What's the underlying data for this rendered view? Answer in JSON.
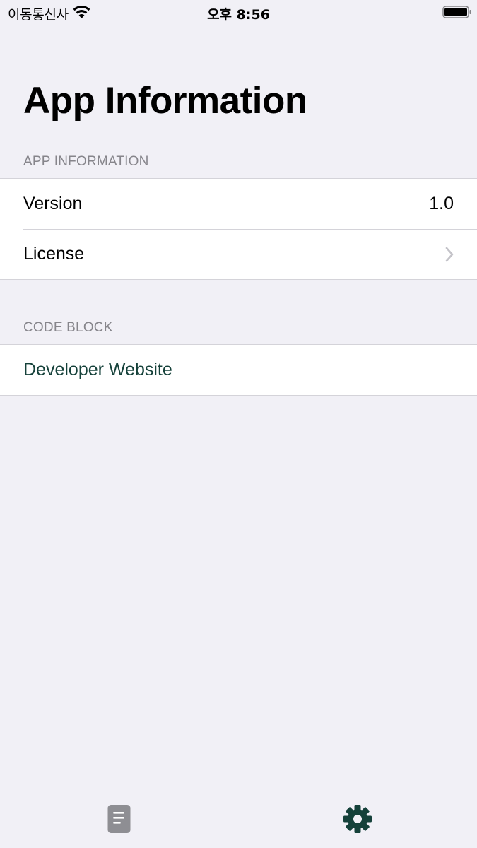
{
  "status_bar": {
    "carrier": "이동통신사",
    "time": "오후 8:56",
    "icons": [
      "wifi-icon",
      "battery-icon"
    ]
  },
  "page": {
    "title": "App Information"
  },
  "sections": {
    "app_information": {
      "header": "APP INFORMATION",
      "version_label": "Version",
      "version_value": "1.0",
      "license_label": "License"
    },
    "code_block": {
      "header": "CODE BLOCK",
      "developer_website_label": "Developer Website"
    }
  },
  "tab_bar": {
    "tabs": [
      {
        "icon": "document-icon",
        "selected": false
      },
      {
        "icon": "gear-icon",
        "selected": true
      }
    ]
  },
  "colors": {
    "background": "#f1f0f6",
    "accent": "#15413a",
    "secondary_text": "#86858b",
    "inactive_tab": "#8e8e93"
  }
}
